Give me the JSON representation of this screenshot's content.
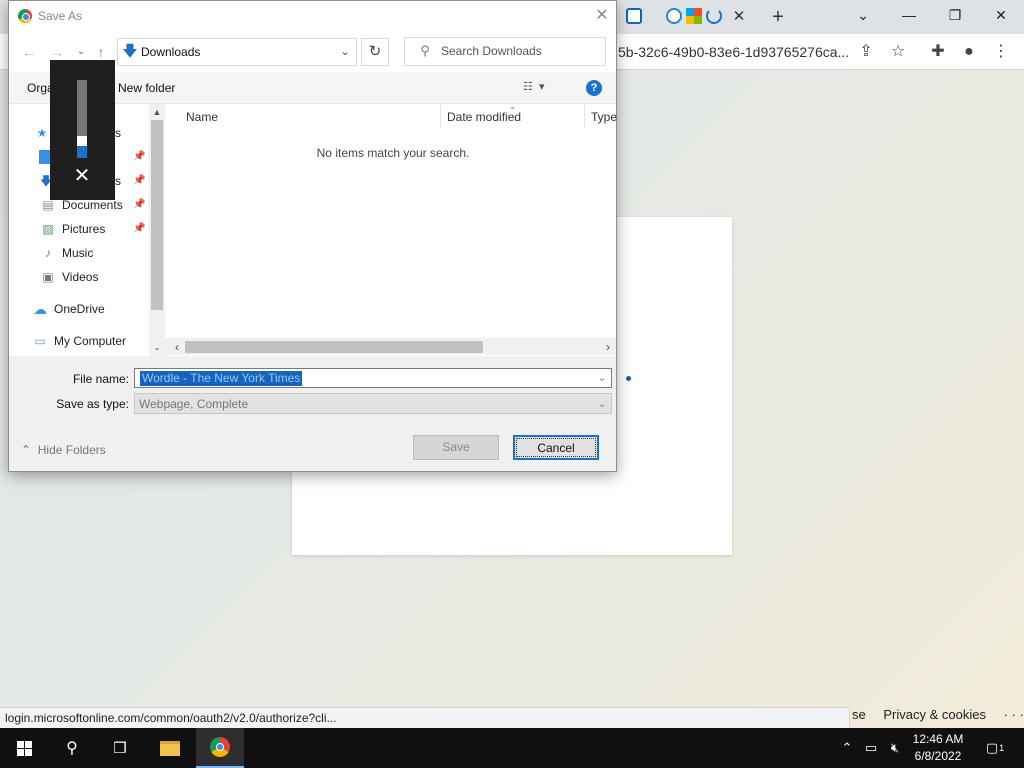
{
  "browser": {
    "address_url": "5b-32c6-49b0-83e6-1d93765276ca...",
    "status_url": "login.microsoftonline.com/common/oauth2/v2.0/authorize?cli...",
    "tab_close": "✕",
    "new_tab": "+",
    "window_controls": {
      "list": "⌄",
      "minimize": "—",
      "restore": "❐",
      "close": "✕"
    },
    "toolbar_icons": [
      "share-icon",
      "star-icon",
      "puzzle-icon",
      "profile-icon",
      "menu-icon"
    ]
  },
  "page": {
    "footer": {
      "partial": "se",
      "privacy": "Privacy & cookies",
      "more": "· · ·"
    }
  },
  "dialog": {
    "title": "Save As",
    "close": "✕",
    "address": {
      "location": "Downloads"
    },
    "search": {
      "placeholder": "Search Downloads"
    },
    "commands": {
      "organize": "Orga",
      "new_folder": "New folder",
      "help": "?"
    },
    "nav_items": [
      {
        "label": "s",
        "icon": "star-icon",
        "pinned": false
      },
      {
        "label": "",
        "icon": "desktop-icon",
        "pinned": true
      },
      {
        "label": "s",
        "icon": "download-icon",
        "pinned": true
      },
      {
        "label": "Documents",
        "icon": "documents-icon",
        "pinned": true
      },
      {
        "label": "Pictures",
        "icon": "pictures-icon",
        "pinned": true
      },
      {
        "label": "Music",
        "icon": "music-icon",
        "pinned": false
      },
      {
        "label": "Videos",
        "icon": "videos-icon",
        "pinned": false
      },
      {
        "label": "OneDrive",
        "icon": "cloud-icon",
        "pinned": false
      },
      {
        "label": "My Computer",
        "icon": "computer-icon",
        "pinned": false
      }
    ],
    "columns": [
      "Name",
      "Date modified",
      "Type"
    ],
    "empty_message": "No items match your search.",
    "file_name_label": "File name:",
    "file_name_value": "Wordle - The New York Times",
    "save_type_label": "Save as type:",
    "save_type_value": "Webpage, Complete",
    "hide_folders": "Hide Folders",
    "save_button": "Save",
    "cancel_button": "Cancel"
  },
  "volume": {
    "level": 0.15,
    "close": "✕"
  },
  "taskbar": {
    "time": "12:46 AM",
    "date": "6/8/2022",
    "notifications": "1"
  }
}
